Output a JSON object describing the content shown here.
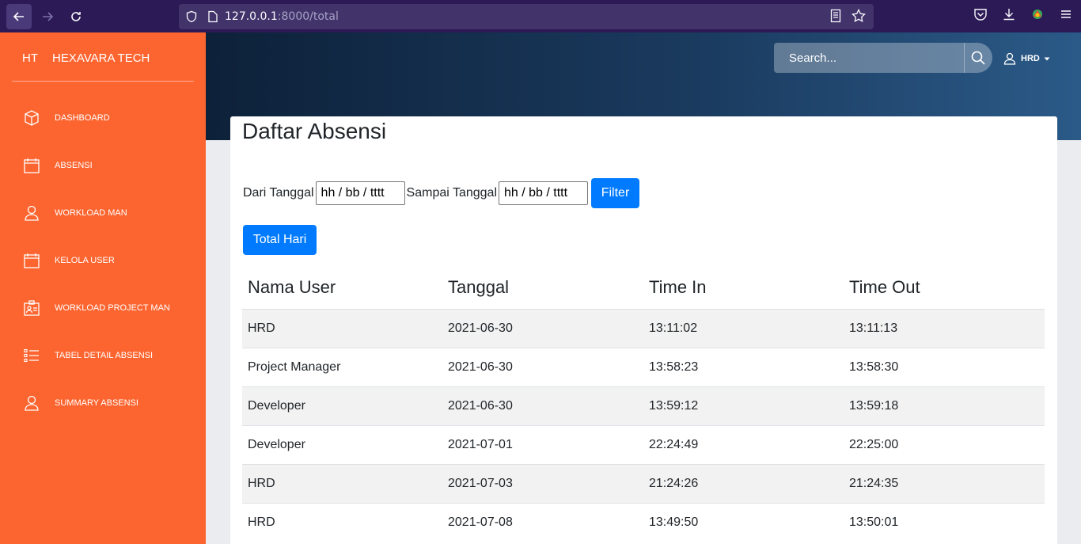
{
  "browser": {
    "url_host": "127.0.0.1",
    "url_path": ":8000/total"
  },
  "sidebar": {
    "brand_short": "HT",
    "brand_name": "HEXAVARA TECH",
    "items": [
      {
        "label": "DASHBOARD",
        "icon": "cube-icon"
      },
      {
        "label": "ABSENSI",
        "icon": "calendar-icon"
      },
      {
        "label": "WORKLOAD MAN",
        "icon": "user-icon"
      },
      {
        "label": "KELOLA USER",
        "icon": "calendar-icon"
      },
      {
        "label": "WORKLOAD PROJECT MAN",
        "icon": "id-badge-icon"
      },
      {
        "label": "TABEL DETAIL ABSENSI",
        "icon": "list-icon"
      },
      {
        "label": "SUMMARY ABSENSI",
        "icon": "user-icon"
      }
    ]
  },
  "header": {
    "search_placeholder": "Search...",
    "user_label": "HRD"
  },
  "main": {
    "title": "Daftar Absensi",
    "filter": {
      "from_label": "Dari Tanggal",
      "from_value": "hh / bb / tttt",
      "to_label": "Sampai Tanggal",
      "to_value": "hh / bb / tttt",
      "button": "Filter"
    },
    "total_button": "Total Hari",
    "table": {
      "columns": [
        "Nama User",
        "Tanggal",
        "Time In",
        "Time Out"
      ],
      "rows": [
        [
          "HRD",
          "2021-06-30",
          "13:11:02",
          "13:11:13"
        ],
        [
          "Project Manager",
          "2021-06-30",
          "13:58:23",
          "13:58:30"
        ],
        [
          "Developer",
          "2021-06-30",
          "13:59:12",
          "13:59:18"
        ],
        [
          "Developer",
          "2021-07-01",
          "22:24:49",
          "22:25:00"
        ],
        [
          "HRD",
          "2021-07-03",
          "21:24:26",
          "21:24:35"
        ],
        [
          "HRD",
          "2021-07-08",
          "13:49:50",
          "13:50:01"
        ]
      ]
    }
  },
  "colors": {
    "sidebar": "#fd6530",
    "primary": "#007bff",
    "browser_bar": "#2b1a55"
  }
}
